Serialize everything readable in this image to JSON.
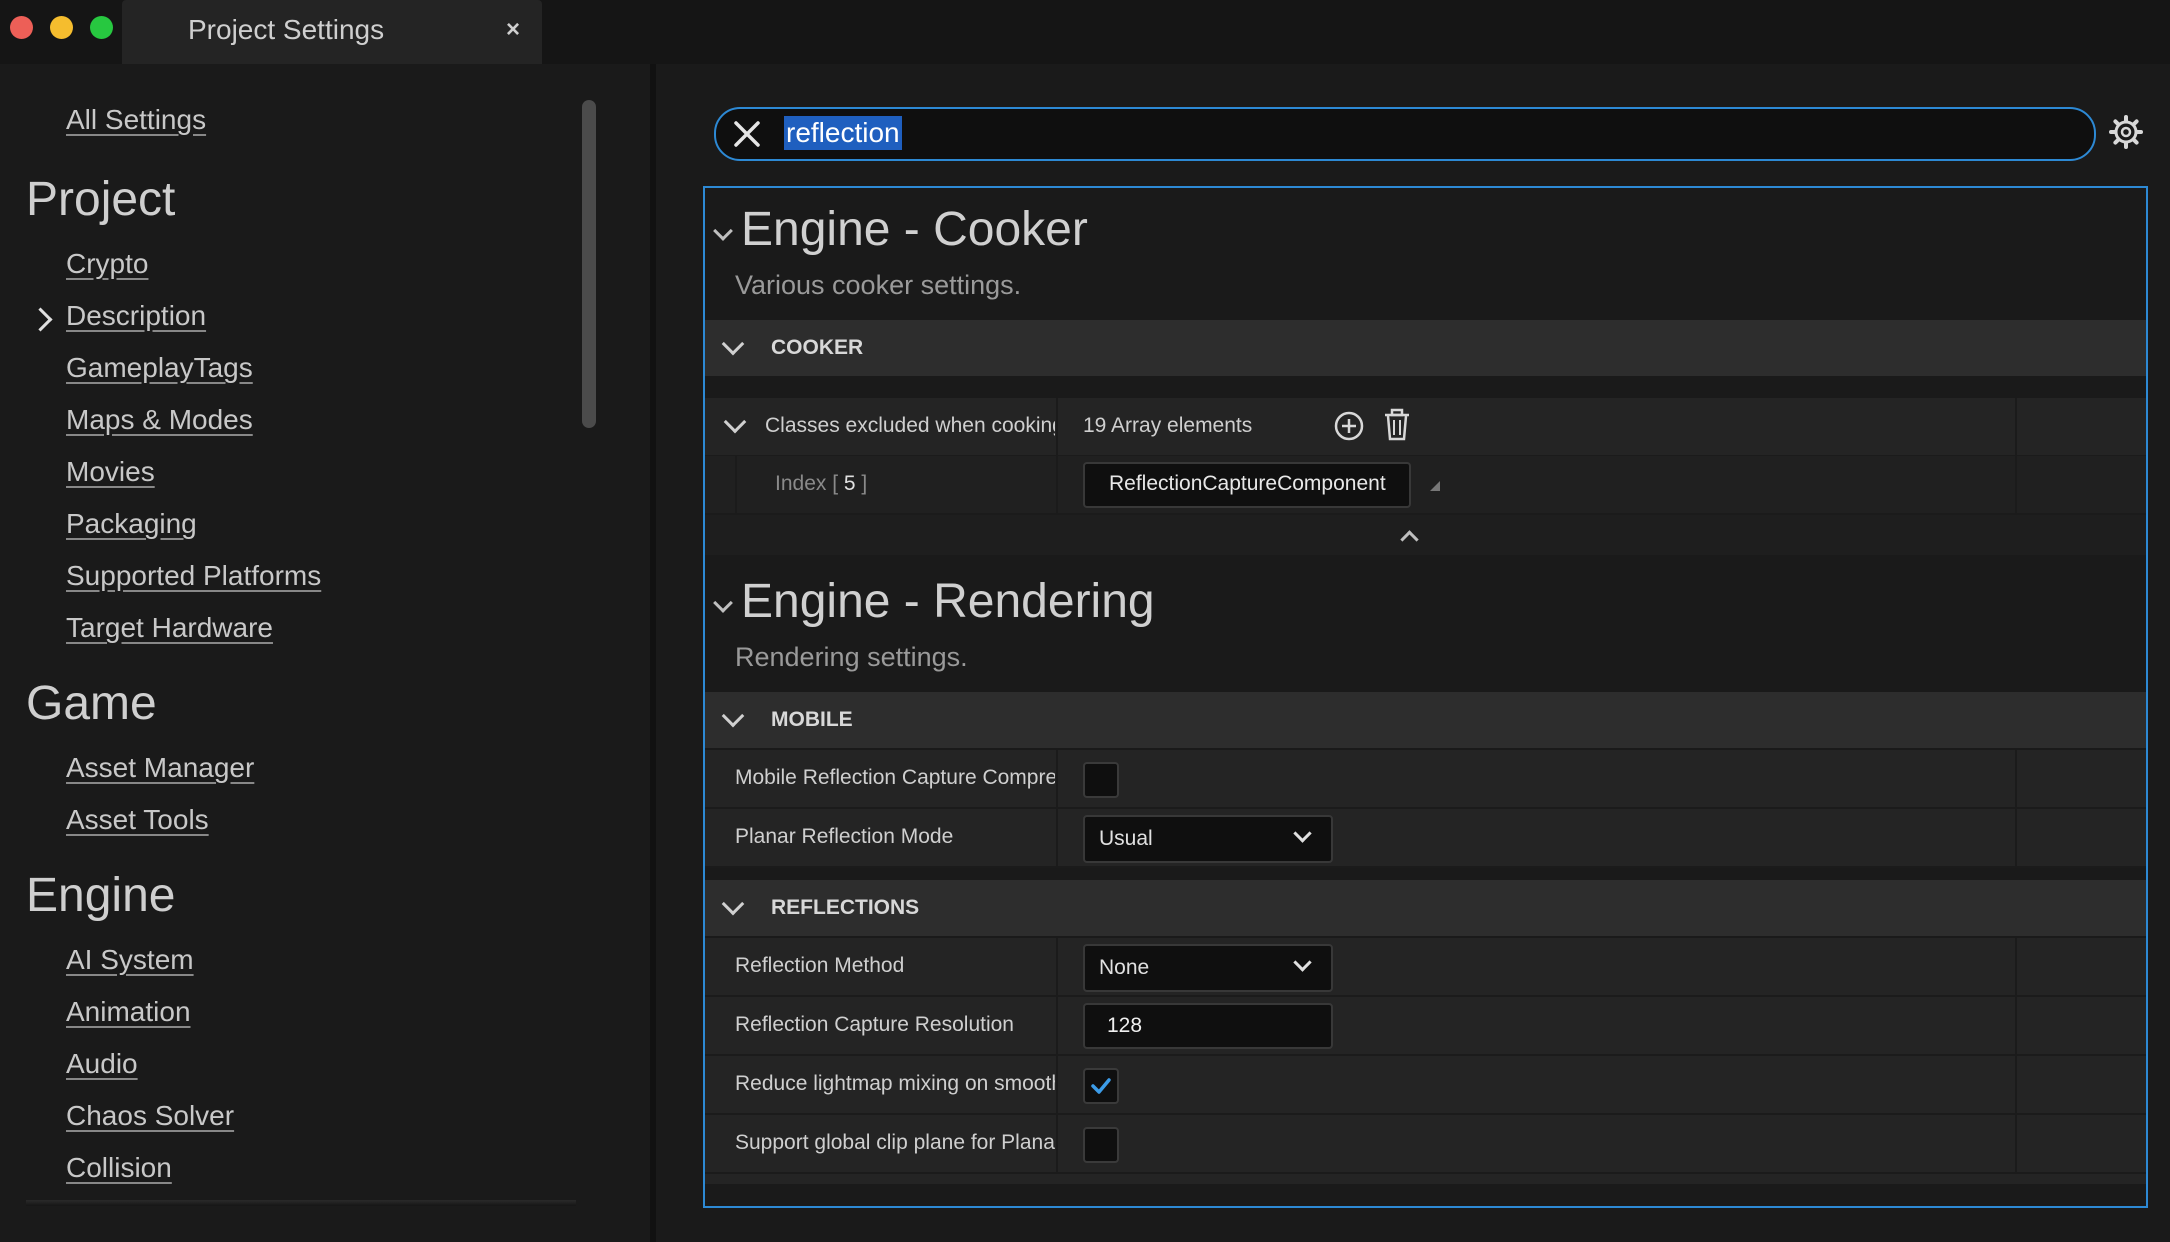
{
  "window": {
    "tab_title": "Project Settings",
    "close_glyph": "×"
  },
  "sidebar": {
    "all_settings": "All Settings",
    "sections": [
      {
        "heading": "Project",
        "items": [
          "Crypto",
          "Description",
          "GameplayTags",
          "Maps & Modes",
          "Movies",
          "Packaging",
          "Supported Platforms",
          "Target Hardware"
        ]
      },
      {
        "heading": "Game",
        "items": [
          "Asset Manager",
          "Asset Tools"
        ]
      },
      {
        "heading": "Engine",
        "items": [
          "AI System",
          "Animation",
          "Audio",
          "Chaos Solver",
          "Collision"
        ]
      }
    ]
  },
  "search": {
    "value": "reflection"
  },
  "sections": {
    "cooker": {
      "title": "Engine - Cooker",
      "description": "Various cooker settings.",
      "category": "COOKER",
      "array_label": "Classes excluded when cooking",
      "array_count": "19 Array elements",
      "index_label": "Index",
      "index_value": "5",
      "element_value": "ReflectionCaptureComponent"
    },
    "rendering": {
      "title": "Engine - Rendering",
      "description": "Rendering settings.",
      "mobile": {
        "category": "MOBILE",
        "rows": [
          {
            "label": "Mobile Reflection Capture Compression",
            "type": "checkbox",
            "checked": false
          },
          {
            "label": "Planar Reflection Mode",
            "type": "combo",
            "value": "Usual"
          }
        ]
      },
      "reflections": {
        "category": "REFLECTIONS",
        "rows": [
          {
            "label": "Reflection Method",
            "type": "combo",
            "value": "None"
          },
          {
            "label": "Reflection Capture Resolution",
            "type": "number",
            "value": "128"
          },
          {
            "label": "Reduce lightmap mixing on smooth surfaces",
            "type": "checkbox",
            "checked": true
          },
          {
            "label": "Support global clip plane for Planar Reflections",
            "type": "checkbox",
            "checked": false
          }
        ]
      }
    }
  },
  "colors": {
    "accent": "#2d89d4",
    "selection": "#1f5fbf"
  }
}
